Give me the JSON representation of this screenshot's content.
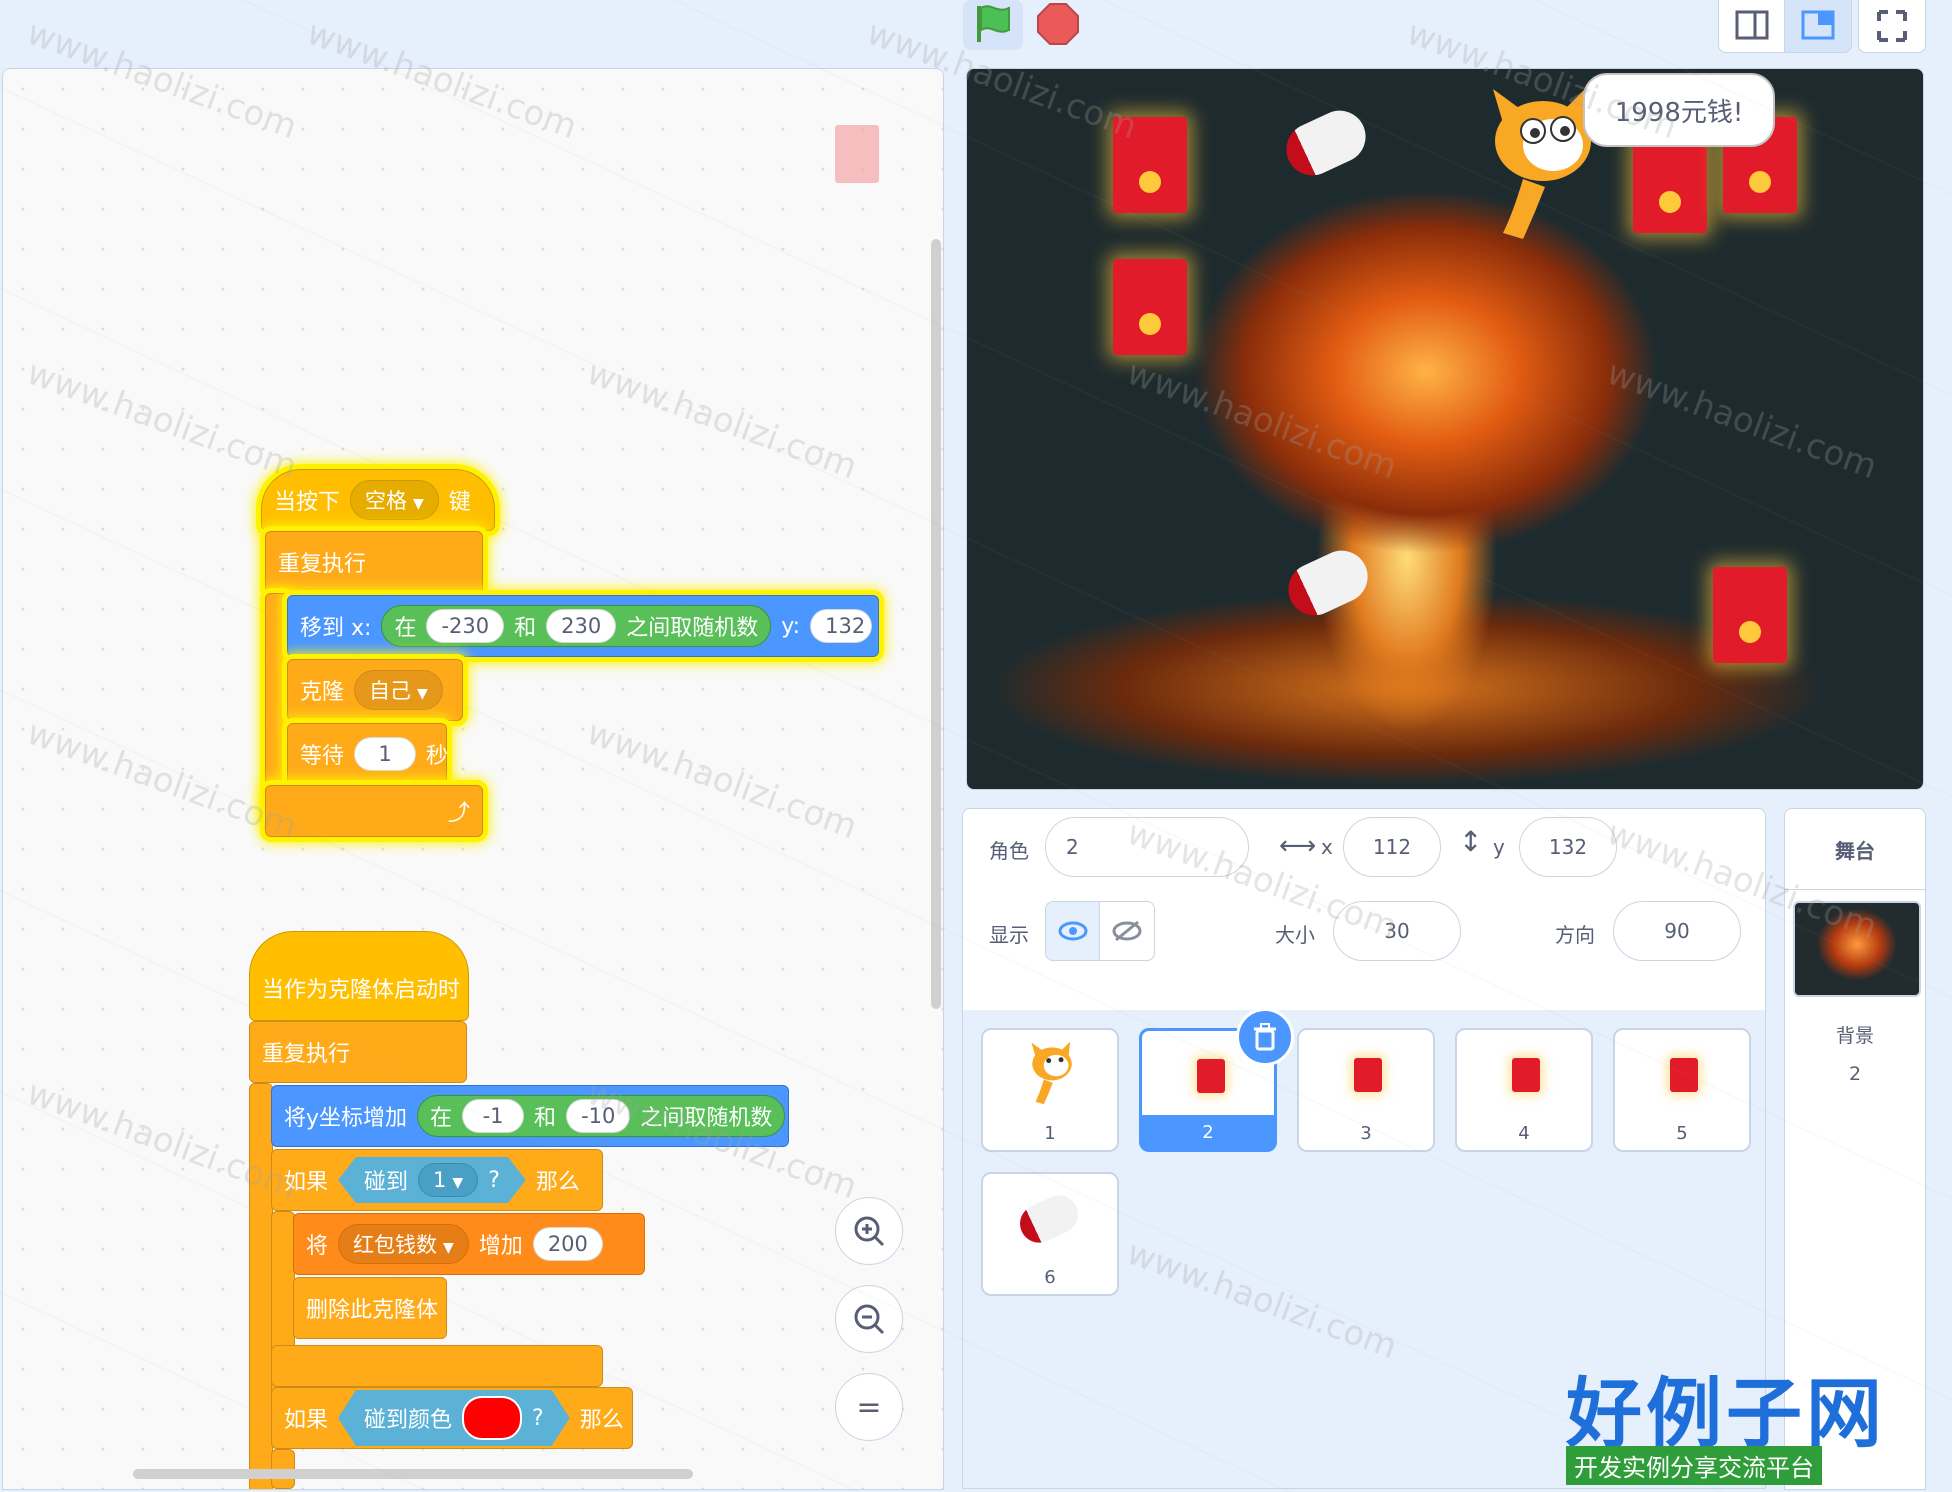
{
  "code": {
    "script1": {
      "hat": {
        "label": "当按下",
        "key": "空格",
        "suffix": "键"
      },
      "forever": "重复执行",
      "goto": {
        "label": "移到 x:",
        "op_in": "在",
        "from": "-230",
        "op_and": "和",
        "to": "230",
        "op_tail": "之间取随机数",
        "y_label": "y:",
        "y": "132"
      },
      "clone": {
        "label": "克隆",
        "target": "自己"
      },
      "wait": {
        "label": "等待",
        "value": "1",
        "unit": "秒"
      }
    },
    "script2": {
      "hat": "当作为克隆体启动时",
      "forever": "重复执行",
      "change_y": {
        "label": "将y坐标增加",
        "op_in": "在",
        "from": "-1",
        "op_and": "和",
        "to": "-10",
        "op_tail": "之间取随机数"
      },
      "if1": {
        "label": "如果",
        "cond": "碰到",
        "target": "1",
        "q": "?",
        "then": "那么"
      },
      "change_var": {
        "label": "将",
        "var": "红包钱数",
        "op": "增加",
        "value": "200"
      },
      "delete_clone": "删除此克隆体",
      "if2": {
        "label": "如果",
        "cond": "碰到颜色",
        "q": "?",
        "then": "那么",
        "color": "#ff0000"
      }
    },
    "zoom": {
      "in": "+",
      "out": "−",
      "reset": "="
    }
  },
  "stage": {
    "speech": "1998元钱!"
  },
  "sprite_info": {
    "sprite_label": "角色",
    "sprite_name": "2",
    "x_label": "x",
    "x": "112",
    "y_label": "y",
    "y": "132",
    "show_label": "显示",
    "size_label": "大小",
    "size": "30",
    "direction_label": "方向",
    "direction": "90"
  },
  "sprites": [
    {
      "num": "1",
      "kind": "cat"
    },
    {
      "num": "2",
      "kind": "redpacket",
      "selected": true
    },
    {
      "num": "3",
      "kind": "redpacket"
    },
    {
      "num": "4",
      "kind": "redpacket"
    },
    {
      "num": "5",
      "kind": "redpacket"
    },
    {
      "num": "6",
      "kind": "rocket"
    }
  ],
  "stage_panel": {
    "title": "舞台",
    "backdrop_label": "背景",
    "backdrop_count": "2"
  },
  "watermark": {
    "title": "好例子网",
    "subtitle": "开发实例分享交流平台",
    "site": "www.haolizi.com"
  },
  "colors": {
    "events": "#ffbf00",
    "control": "#ffab19",
    "motion": "#4c97ff",
    "operators": "#59c059",
    "sensing": "#5cb1d6",
    "variables": "#ff8c1a",
    "accent": "#4c97ff"
  }
}
